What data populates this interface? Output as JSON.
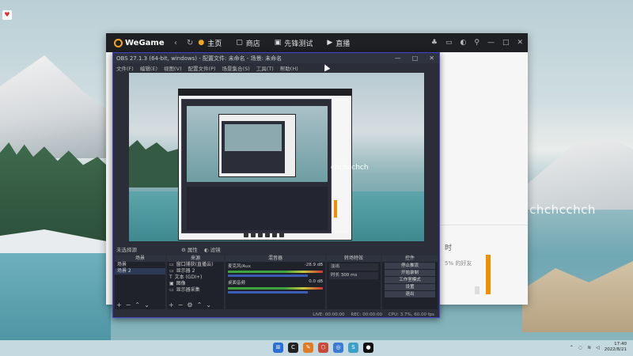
{
  "wegame": {
    "logo": "WeGame",
    "nav_back": "‹",
    "nav_refresh": "↻",
    "tabs": [
      {
        "label": "主页",
        "icon": "●"
      },
      {
        "label": "商店",
        "icon": "▢"
      },
      {
        "label": "先锋测试",
        "icon": "▣"
      },
      {
        "label": "直播",
        "icon": "▶"
      }
    ],
    "right_icons": [
      "♣",
      "▭",
      "◐",
      "⚲",
      "—",
      "□",
      "✕"
    ],
    "side_text_1": "时",
    "side_text_2": "5% 的好友"
  },
  "obs": {
    "title": "OBS 27.1.3 (64-bit, windows) - 配置文件: 未命名 - 场景: 未命名",
    "window_controls": [
      "—",
      "□",
      "✕"
    ],
    "menu": [
      "文件(F)",
      "编辑(E)",
      "视图(V)",
      "配置文件(P)",
      "场景集合(S)",
      "工具(T)",
      "帮助(H)"
    ],
    "no_scene": "未选择源",
    "props_button": "属性",
    "filters_button": "滤镜",
    "scenes_header": "场景",
    "scenes": [
      "场景",
      "场景 2"
    ],
    "sources_header": "来源",
    "sources": [
      "窗口捕获(直播云)",
      "显示器 2",
      "文本 (GDI+)",
      "图像",
      "显示器采集"
    ],
    "mixer_header": "混音器",
    "mixer": [
      {
        "name": "麦克风/Aux",
        "db": "-28.9 dB"
      },
      {
        "name": "桌面音频",
        "db": "0.0 dB"
      }
    ],
    "transitions_header": "转场特效",
    "transition": "淡出",
    "duration_label": "时长",
    "duration": "300 ms",
    "controls_header": "控件",
    "controls": [
      "停止推流",
      "开始录制",
      "工作室模式",
      "设置",
      "退出"
    ],
    "status": [
      "LIVE: 00:00:00",
      "REC: 00:00:00",
      "CPU: 3.7%, 60.00 fps"
    ]
  },
  "preview": {
    "watermark": "chchcchch"
  },
  "desktop": {
    "watermark": "VX:chchcchch",
    "clock_time": "17:40",
    "clock_date": "2022/8/21"
  },
  "taskbar": {
    "icons": [
      "⊞",
      "C",
      "✎",
      "⬡",
      "◎",
      "S",
      "●"
    ]
  }
}
